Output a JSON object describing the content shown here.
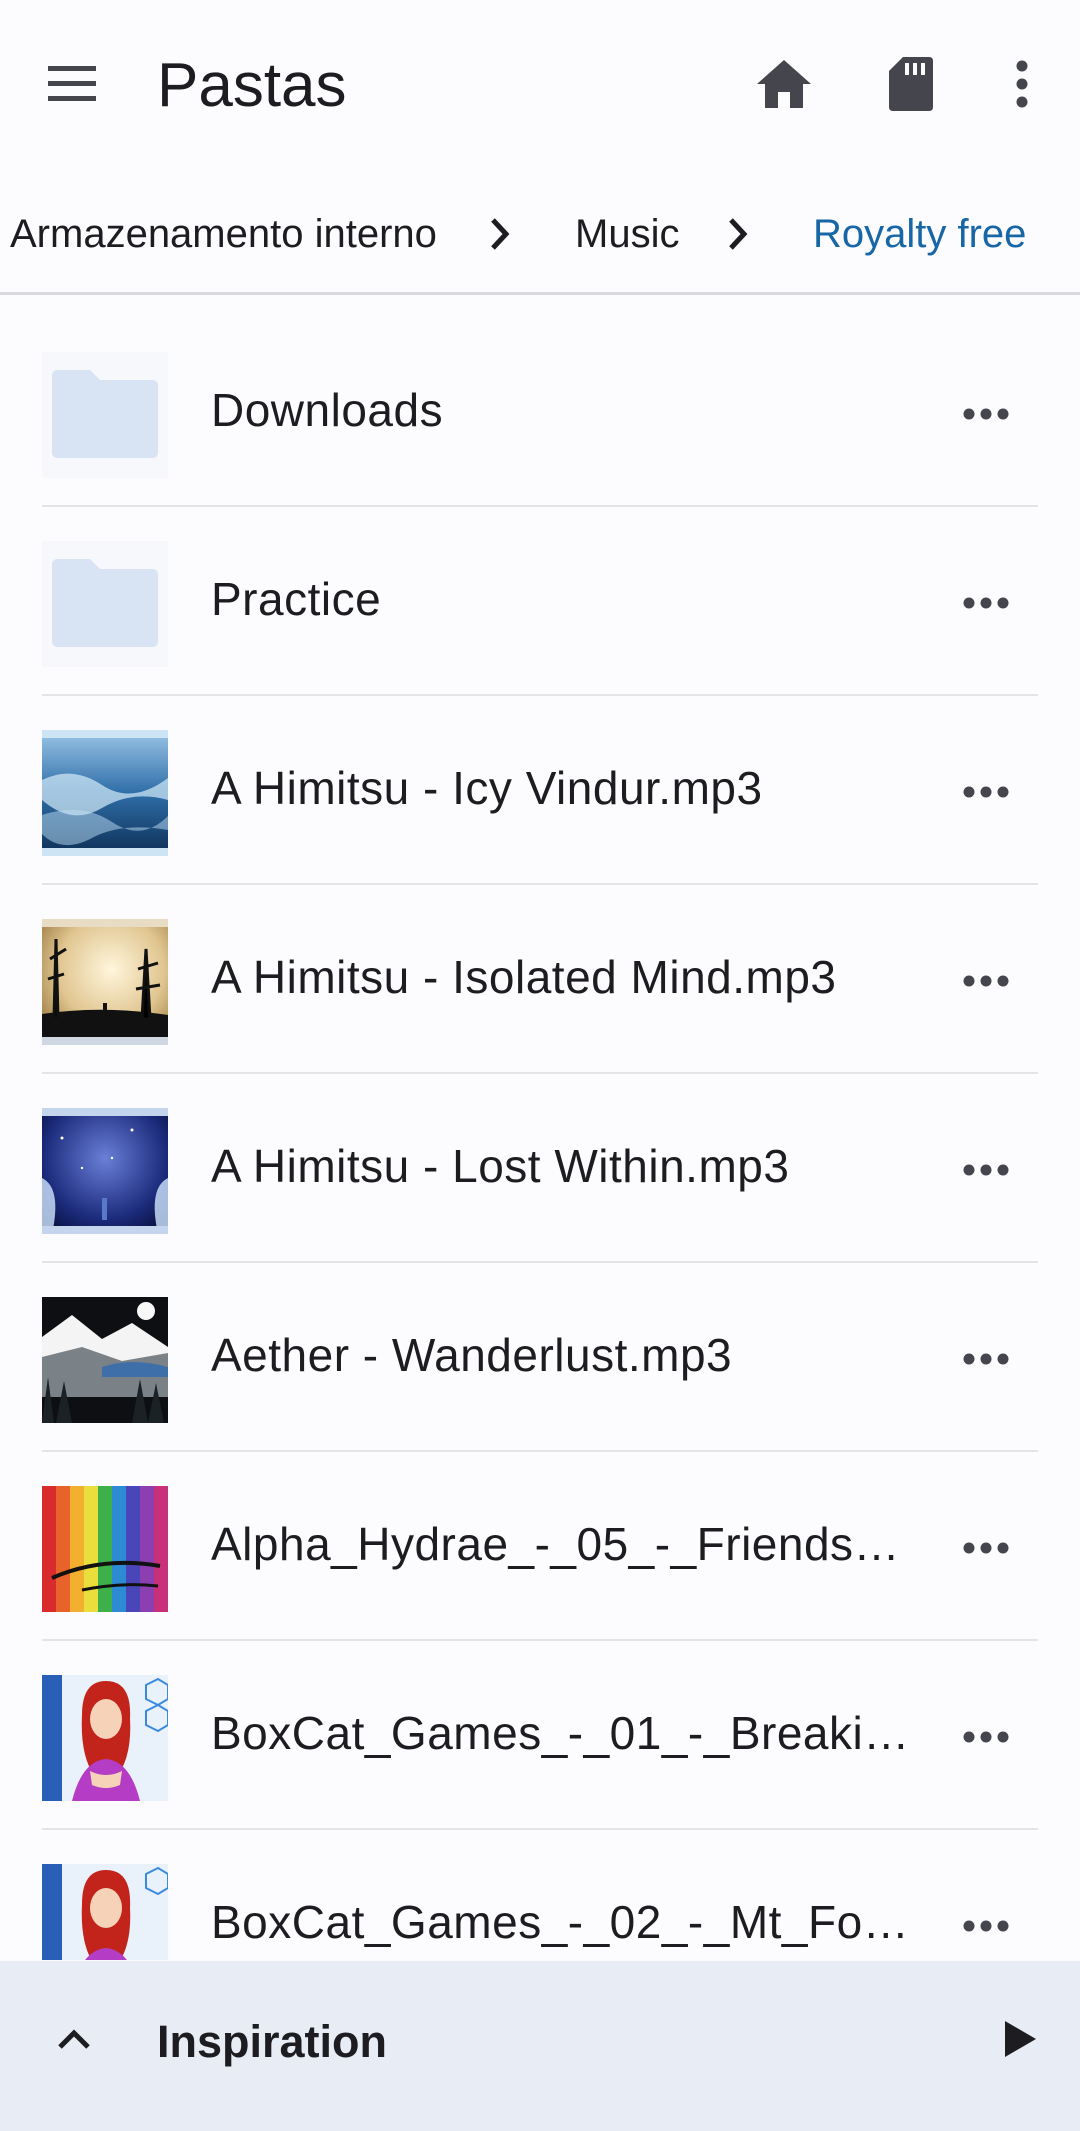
{
  "toolbar": {
    "title": "Pastas",
    "menu_icon": "hamburger-menu-icon",
    "actions": [
      "home-icon",
      "sd-card-icon",
      "more-vert-icon"
    ]
  },
  "breadcrumb": {
    "items": [
      "Armazenamento interno",
      "Music",
      "Royalty free"
    ],
    "separator_icon": "chevron-right-icon"
  },
  "files": [
    {
      "name": "Downloads",
      "thumb": "folder-icon"
    },
    {
      "name": "Practice",
      "thumb": "folder-icon"
    },
    {
      "name": "A Himitsu - Icy Vindur.mp3",
      "thumb": "album-art"
    },
    {
      "name": "A Himitsu - Isolated Mind.mp3",
      "thumb": "album-art"
    },
    {
      "name": "A Himitsu - Lost Within.mp3",
      "thumb": "album-art"
    },
    {
      "name": "Aether - Wanderlust.mp3",
      "thumb": "album-art"
    },
    {
      "name": "Alpha_Hydrae_-_05_-_Friends_…",
      "thumb": "album-art"
    },
    {
      "name": "BoxCat_Games_-_01_-_Breakin…",
      "thumb": "album-art"
    },
    {
      "name": "BoxCat_Games_-_02_-_Mt_Fox…",
      "thumb": "album-art"
    }
  ],
  "row_more_icon": "more-horiz-icon",
  "player": {
    "track_title": "Inspiration",
    "expand_icon": "chevron-up-icon",
    "play_icon": "play-icon"
  },
  "colors": {
    "accent": "#1766a6",
    "folder": "#d8e3f3",
    "player_bg": "#e8edf5",
    "icon": "#45464d"
  }
}
